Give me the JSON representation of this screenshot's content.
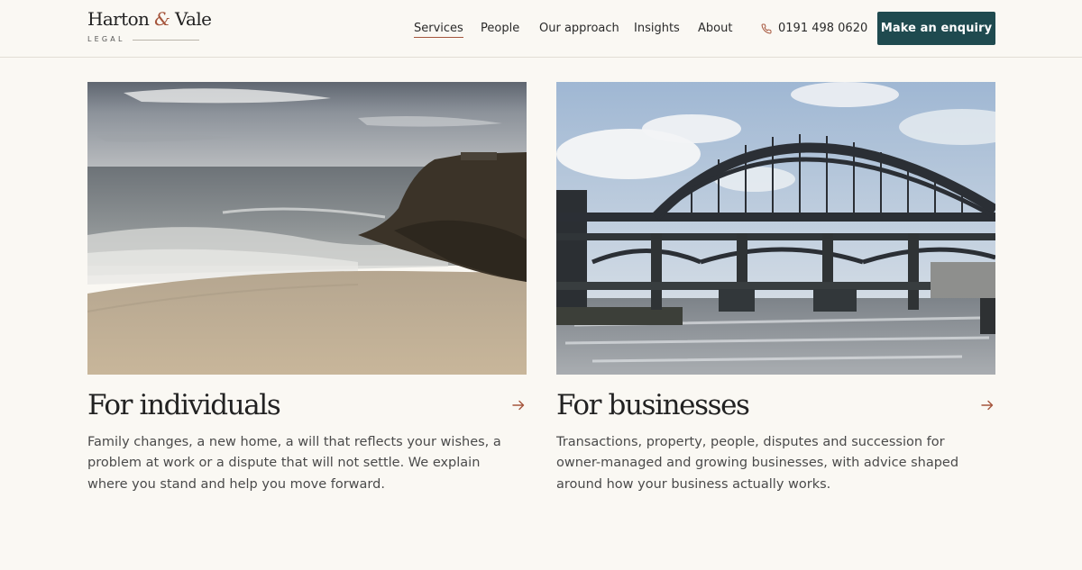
{
  "brand": {
    "name_part1": "Harton",
    "amp": "&",
    "name_part2": "Vale",
    "sub": "LEGAL"
  },
  "nav": {
    "items": [
      {
        "label": "Services",
        "active": true
      },
      {
        "label": "People"
      },
      {
        "label": "Our approach"
      },
      {
        "label": "Insights"
      },
      {
        "label": "About"
      }
    ],
    "phone": "0191 498 0620",
    "cta": "Make an enquiry"
  },
  "cards": [
    {
      "title": "For individuals",
      "text": "Family changes, a new home, a will that reflects your wishes, a problem at work or a dispute that will not settle. We explain where you stand and help you move forward.",
      "image": "coastal-beach-cliff"
    },
    {
      "title": "For businesses",
      "text": "Transactions, property, people, disputes and succession for owner-managed and growing businesses, with advice shaped around how your business actually works.",
      "image": "river-arch-bridge"
    }
  ],
  "colors": {
    "background": "#faf8f3",
    "accent": "#a5553c",
    "button": "#1f4a4f"
  },
  "icons": [
    "phone-icon",
    "arrow-right-icon"
  ]
}
